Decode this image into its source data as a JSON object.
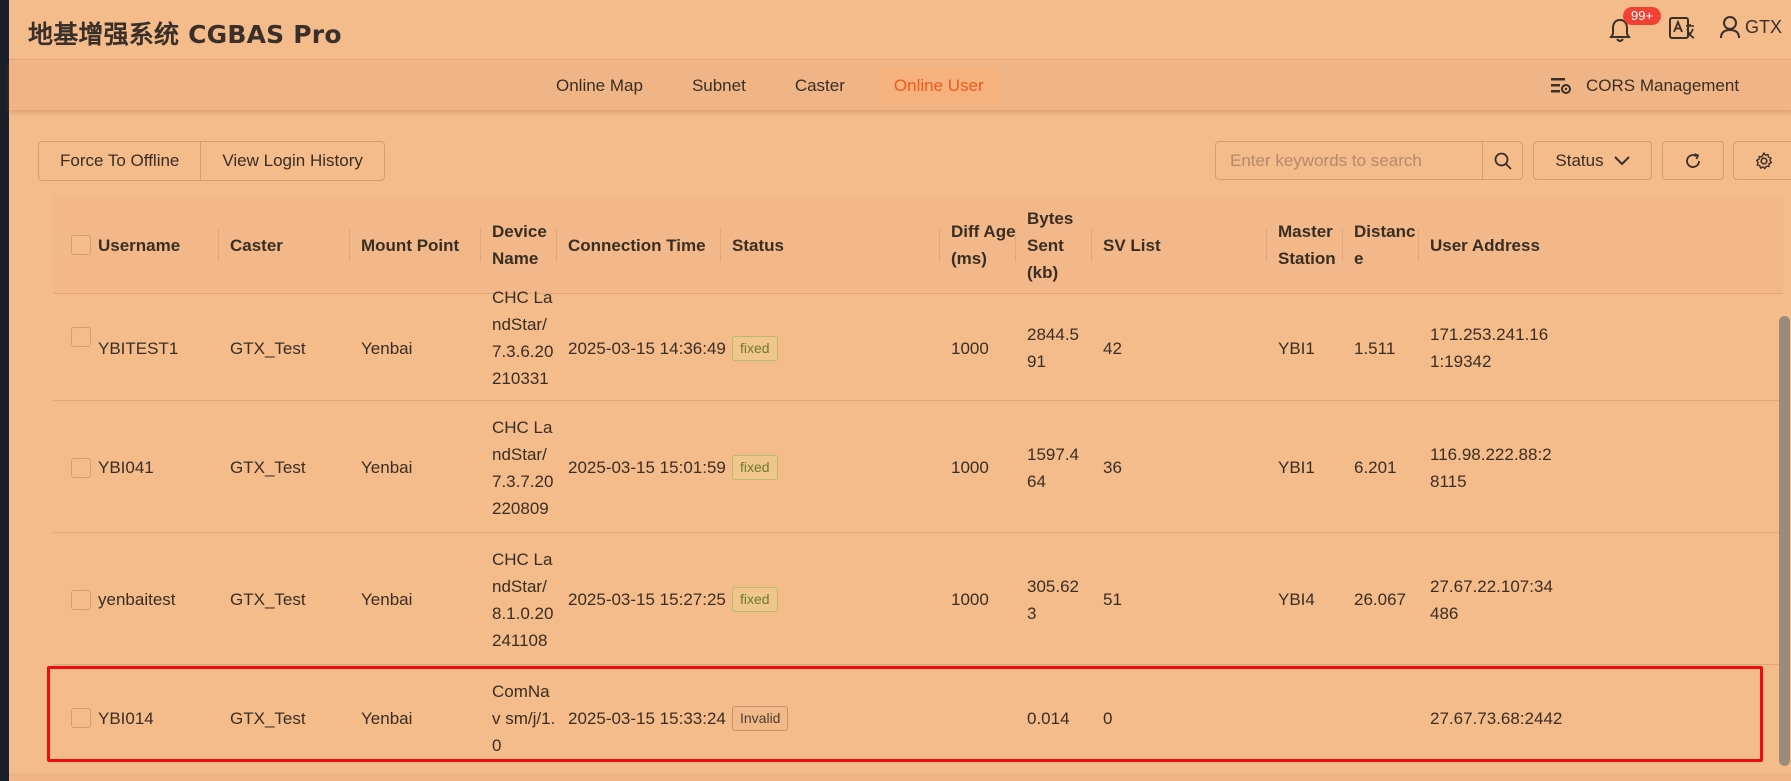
{
  "app": {
    "title": "地基增强系统 CGBAS Pro"
  },
  "header": {
    "notification_badge": "99+",
    "user_name": "GTX"
  },
  "nav": {
    "tabs": [
      "Online Map",
      "Subnet",
      "Caster",
      "Online User"
    ],
    "active_tab": "Online User",
    "cors_management": "CORS Management"
  },
  "toolbar": {
    "force_offline_label": "Force To Offline",
    "view_login_history_label": "View Login History",
    "search_placeholder": "Enter keywords to search",
    "status_label": "Status"
  },
  "table": {
    "columns": {
      "username": "Username",
      "caster": "Caster",
      "mount_point": "Mount Point",
      "device_name": "Device Name",
      "connection_time": "Connection Time",
      "status": "Status",
      "diff_age": "Diff Age (ms)",
      "bytes_sent": "Bytes Sent (kb)",
      "sv_list": "SV List",
      "master_station": "Master Station",
      "distance": "Distance",
      "user_address": "User Address"
    },
    "rows": [
      {
        "username": "YBITEST1",
        "caster": "GTX_Test",
        "mount_point": "Yenbai",
        "device_name": "CHC LandStar/7.3.6.20210331",
        "connection_time": "2025-03-15 14:36:49",
        "status": "fixed",
        "diff_age": "1000",
        "bytes_sent": "2844.591",
        "sv_list": "42",
        "master_station": "YBI1",
        "distance": "1.511",
        "user_address": "171.253.241.161:19342"
      },
      {
        "username": "YBI041",
        "caster": "GTX_Test",
        "mount_point": "Yenbai",
        "device_name": "CHC LandStar/7.3.7.20220809",
        "connection_time": "2025-03-15 15:01:59",
        "status": "fixed",
        "diff_age": "1000",
        "bytes_sent": "1597.464",
        "sv_list": "36",
        "master_station": "YBI1",
        "distance": "6.201",
        "user_address": "116.98.222.88:28115"
      },
      {
        "username": "yenbaitest",
        "caster": "GTX_Test",
        "mount_point": "Yenbai",
        "device_name": "CHC LandStar/8.1.0.20241108",
        "connection_time": "2025-03-15 15:27:25",
        "status": "fixed",
        "diff_age": "1000",
        "bytes_sent": "305.623",
        "sv_list": "51",
        "master_station": "YBI4",
        "distance": "26.067",
        "user_address": "27.67.22.107:34486"
      },
      {
        "username": "YBI014",
        "caster": "GTX_Test",
        "mount_point": "Yenbai",
        "device_name": "ComNav sm/j/1.0",
        "connection_time": "2025-03-15 15:33:24",
        "status": "Invalid",
        "diff_age": "",
        "bytes_sent": "0.014",
        "sv_list": "0",
        "master_station": "",
        "distance": "",
        "user_address": "27.67.73.68:2442"
      }
    ]
  },
  "colors": {
    "background": "#f4bb8b",
    "accent": "#f05a1c",
    "highlight_border": "#f00c0c",
    "badge": "#f04134"
  }
}
